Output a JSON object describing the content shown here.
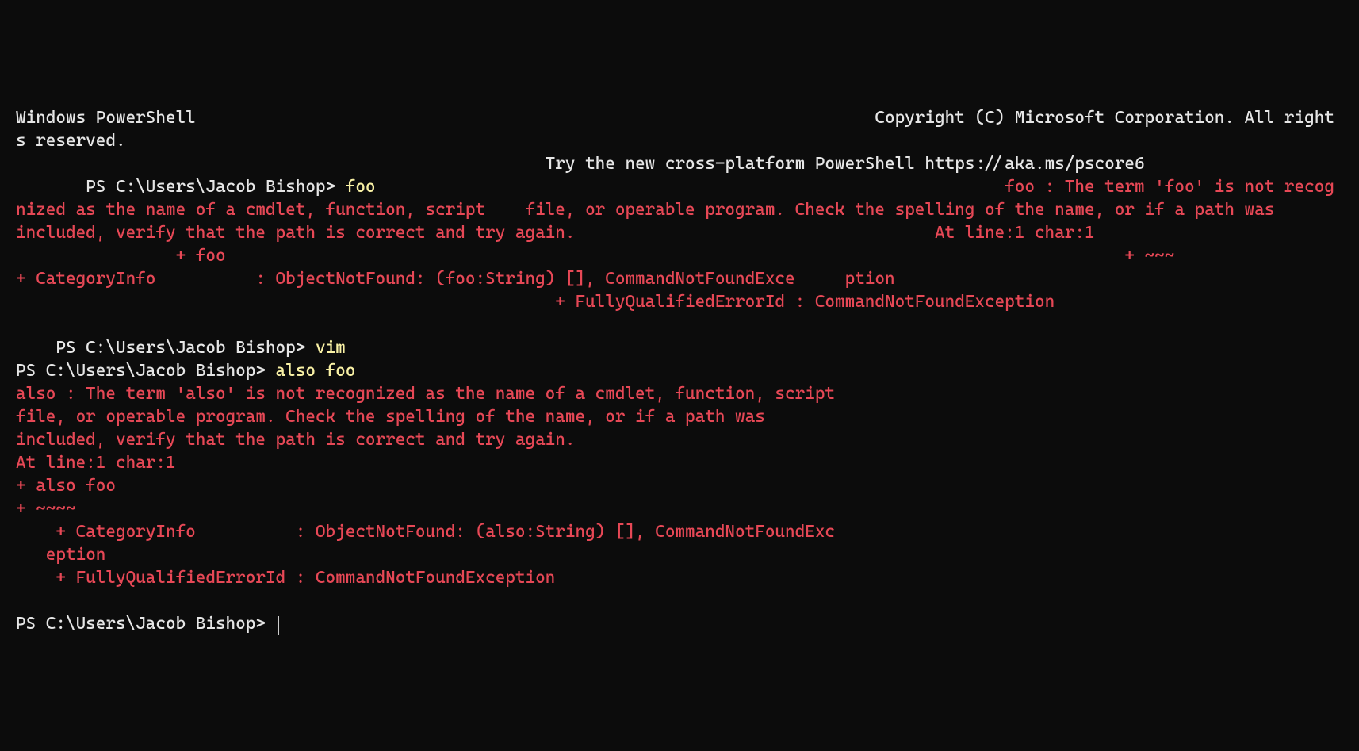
{
  "header": {
    "title_line": "Windows PowerShell                                                                    Copyright (C) Microsoft Corporation. All rights reserved.",
    "tip_line": "                                                     Try the new cross-platform PowerShell https://aka.ms/pscore6"
  },
  "cmd1": {
    "prompt_indent": "       ",
    "prompt": "PS C:\\Users\\Jacob Bishop> ",
    "command": "foo",
    "tail_gap": "                                                               ",
    "error_begin": "foo : The term 'foo' is not recognized as the name of a cmdlet, function, script    file, or operable program. Check the spelling of the name, or if a path was          included, verify that the path is correct and try again.                                    At line:1 char:1",
    "error_l2": "                + foo                                                                                          + ~~~                                                                                               + CategoryInfo          : ObjectNotFound: (foo:String) [], CommandNotFoundExce     ption",
    "error_l3": "                                                      + FullyQualifiedErrorId : CommandNotFoundException"
  },
  "cmd2": {
    "prompt_indent": "    ",
    "prompt": "PS C:\\Users\\Jacob Bishop> ",
    "command": "vim"
  },
  "cmd3": {
    "prompt": "PS C:\\Users\\Jacob Bishop> ",
    "command": "also foo",
    "error_l1": "also : The term 'also' is not recognized as the name of a cmdlet, function, script",
    "error_l2": "file, or operable program. Check the spelling of the name, or if a path was",
    "error_l3": "included, verify that the path is correct and try again.",
    "error_l4": "At line:1 char:1",
    "error_l5": "+ also foo",
    "error_l6": "+ ~~~~",
    "error_l7": "    + CategoryInfo          : ObjectNotFound: (also:String) [], CommandNotFoundExc",
    "error_l8": "   eption",
    "error_l9": "    + FullyQualifiedErrorId : CommandNotFoundException"
  },
  "prompt_final": {
    "prompt": "PS C:\\Users\\Jacob Bishop> "
  }
}
